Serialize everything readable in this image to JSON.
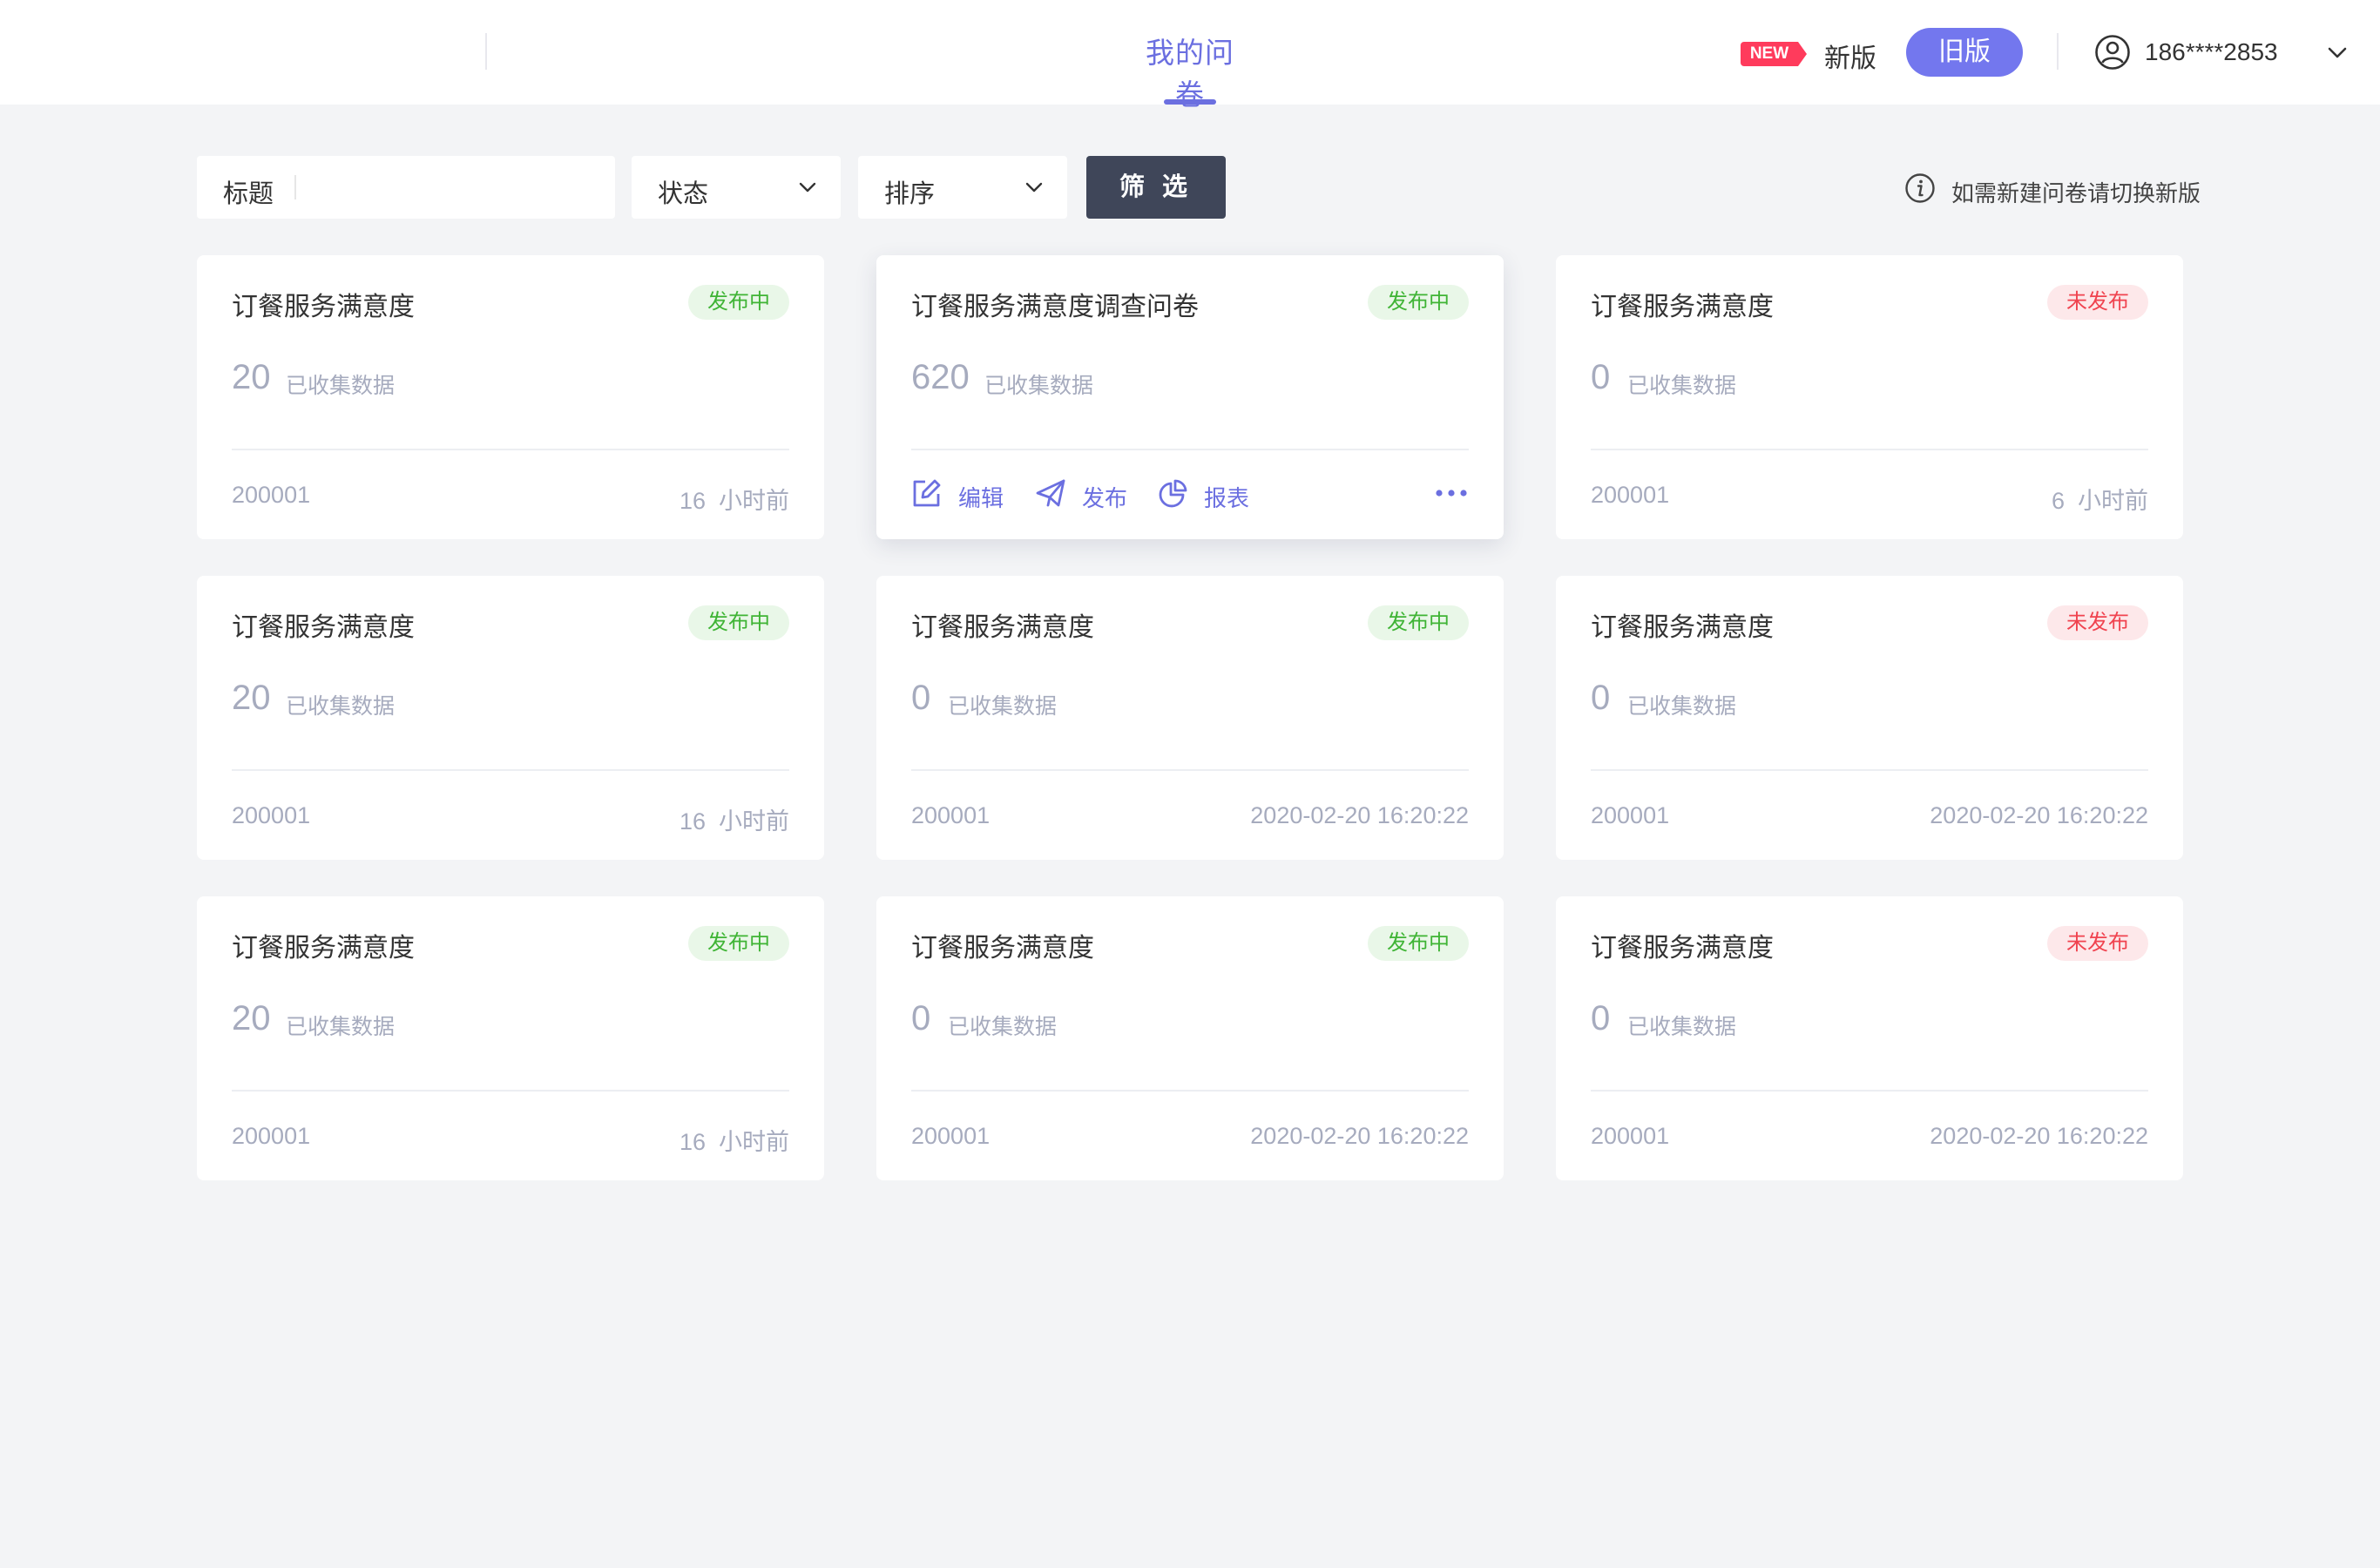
{
  "header": {
    "page_title": "我的问卷",
    "new_badge": "NEW",
    "new_version_label": "新版",
    "old_version_label": "旧版",
    "user_phone": "186****2853"
  },
  "filters": {
    "title_label": "标题",
    "title_value": "",
    "status_label": "状态",
    "sort_label": "排序",
    "filter_button": "筛 选",
    "info_tip": "如需新建问卷请切换新版"
  },
  "card_actions": {
    "edit": "编辑",
    "publish": "发布",
    "report": "报表"
  },
  "colors": {
    "accent": "#6b6fe0",
    "published_text": "#3fb435",
    "published_bg": "#e9f7e8",
    "unpublished_text": "#f0434f",
    "unpublished_bg": "#fde8ea",
    "filter_button_bg": "#3f4659"
  },
  "cards": [
    {
      "title": "订餐服务满意度",
      "status": "发布中",
      "count": "20",
      "count_label": "已收集数据",
      "id": "200001",
      "time": "16  小时前"
    },
    {
      "title": "订餐服务满意度调查问卷",
      "status": "发布中",
      "count": "620",
      "count_label": "已收集数据",
      "id": "",
      "time": ""
    },
    {
      "title": "订餐服务满意度",
      "status": "未发布",
      "count": "0",
      "count_label": "已收集数据",
      "id": "200001",
      "time": "6  小时前"
    },
    {
      "title": "订餐服务满意度",
      "status": "发布中",
      "count": "20",
      "count_label": "已收集数据",
      "id": "200001",
      "time": "16  小时前"
    },
    {
      "title": "订餐服务满意度",
      "status": "发布中",
      "count": "0",
      "count_label": "已收集数据",
      "id": "200001",
      "time": "2020-02-20 16:20:22"
    },
    {
      "title": "订餐服务满意度",
      "status": "未发布",
      "count": "0",
      "count_label": "已收集数据",
      "id": "200001",
      "time": "2020-02-20 16:20:22"
    },
    {
      "title": "订餐服务满意度",
      "status": "发布中",
      "count": "20",
      "count_label": "已收集数据",
      "id": "200001",
      "time": "16  小时前"
    },
    {
      "title": "订餐服务满意度",
      "status": "发布中",
      "count": "0",
      "count_label": "已收集数据",
      "id": "200001",
      "time": "2020-02-20 16:20:22"
    },
    {
      "title": "订餐服务满意度",
      "status": "未发布",
      "count": "0",
      "count_label": "已收集数据",
      "id": "200001",
      "time": "2020-02-20 16:20:22"
    }
  ]
}
